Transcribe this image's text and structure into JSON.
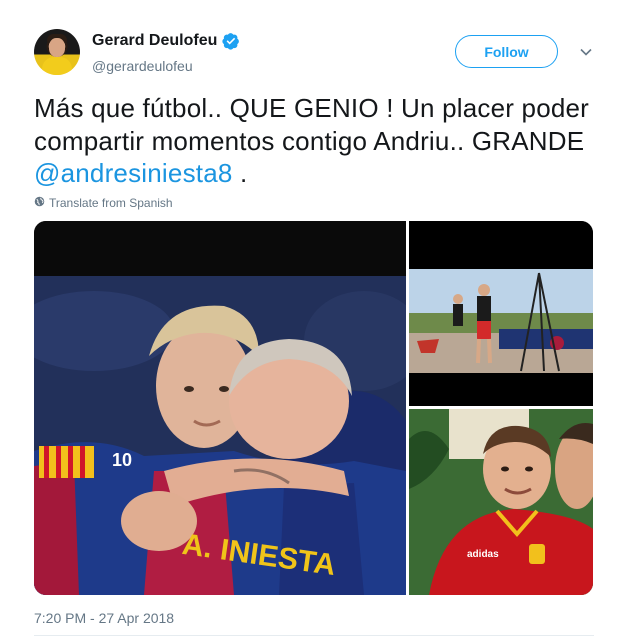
{
  "header": {
    "display_name": "Gerard Deulofeu",
    "handle": "@gerardeulofeu",
    "follow_label": "Follow",
    "verified_icon": "verified-badge-icon",
    "more_icon": "chevron-down-icon"
  },
  "tweet": {
    "text_before_mention": "Más que fútbol.. QUE GENIO ! Un placer poder compartir momentos contigo Andriu.. GRANDE ",
    "mention": "@andresiniesta8",
    "text_after_mention": " .",
    "translate_label": "Translate from Spanish",
    "translate_icon": "globe-icon",
    "timestamp": "7:20 PM - 27 Apr 2018"
  },
  "media": {
    "count": 3,
    "main_jersey_text": "A. INIESTA",
    "main_number": "10"
  },
  "colors": {
    "accent": "#1da1f2",
    "mention": "#1b95e0",
    "secondary_text": "#657786",
    "primary_text": "#14171a"
  }
}
